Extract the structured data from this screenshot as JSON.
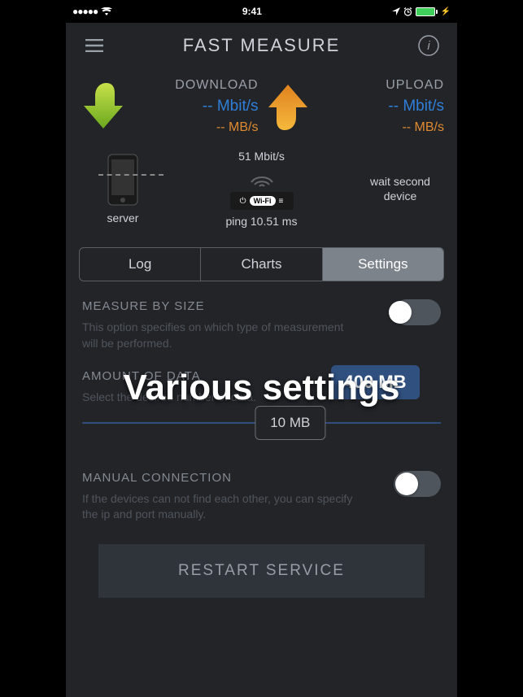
{
  "status": {
    "signal": "●●●●●",
    "time": "9:41"
  },
  "nav": {
    "title": "FAST MEASURE"
  },
  "download": {
    "label": "DOWNLOAD",
    "mbit": "-- Mbit/s",
    "mb": "-- MB/s"
  },
  "upload": {
    "label": "UPLOAD",
    "mbit": "-- Mbit/s",
    "mb": "-- MB/s"
  },
  "diagram": {
    "server_label": "server",
    "rate": "51 Mbit/s",
    "router_label": "Wi-Fi",
    "ping": "ping 10.51 ms",
    "wait": "wait second device"
  },
  "tabs": {
    "log": "Log",
    "charts": "Charts",
    "settings": "Settings"
  },
  "measure": {
    "title": "MEASURE BY SIZE",
    "desc": "This option specifies on which type of measurement will be performed."
  },
  "amount": {
    "title": "AMOUNT OF DATA",
    "desc": "Select the desired number of data.",
    "tooltip": "400 MB",
    "value": "10 MB"
  },
  "manual": {
    "title": "MANUAL CONNECTION",
    "desc": "If the devices can not find each other, you can specify the ip and port manually."
  },
  "restart": "RESTART SERVICE",
  "overlay": "Various settings"
}
